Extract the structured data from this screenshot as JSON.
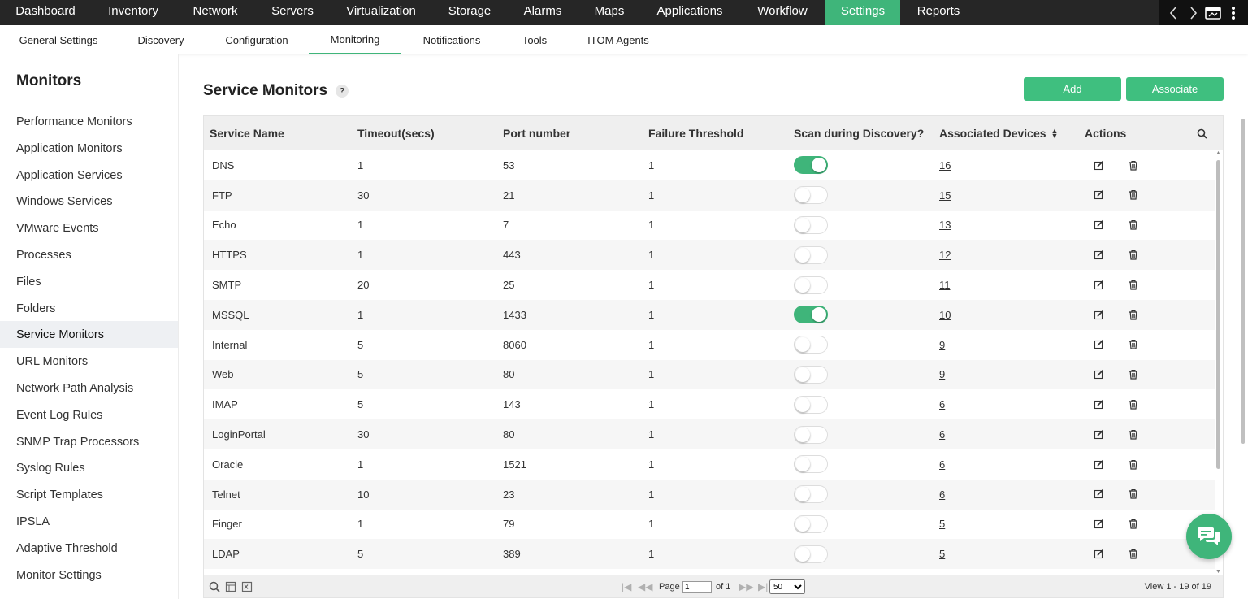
{
  "topnav": {
    "items": [
      {
        "label": "Dashboard",
        "active": false
      },
      {
        "label": "Inventory",
        "active": false
      },
      {
        "label": "Network",
        "active": false
      },
      {
        "label": "Servers",
        "active": false
      },
      {
        "label": "Virtualization",
        "active": false
      },
      {
        "label": "Storage",
        "active": false
      },
      {
        "label": "Alarms",
        "active": false
      },
      {
        "label": "Maps",
        "active": false
      },
      {
        "label": "Applications",
        "active": false
      },
      {
        "label": "Workflow",
        "active": false
      },
      {
        "label": "Settings",
        "active": true
      },
      {
        "label": "Reports",
        "active": false
      }
    ],
    "tools": [
      "chevron-left-icon",
      "chevron-right-icon",
      "window-icon",
      "more-vertical-icon"
    ]
  },
  "subnav": {
    "items": [
      {
        "label": "General Settings",
        "active": false
      },
      {
        "label": "Discovery",
        "active": false
      },
      {
        "label": "Configuration",
        "active": false
      },
      {
        "label": "Monitoring",
        "active": true
      },
      {
        "label": "Notifications",
        "active": false
      },
      {
        "label": "Tools",
        "active": false
      },
      {
        "label": "ITOM Agents",
        "active": false
      }
    ]
  },
  "sidebar": {
    "title": "Monitors",
    "items": [
      {
        "label": "Performance Monitors",
        "active": false
      },
      {
        "label": "Application Monitors",
        "active": false
      },
      {
        "label": "Application Services",
        "active": false
      },
      {
        "label": "Windows Services",
        "active": false
      },
      {
        "label": "VMware Events",
        "active": false
      },
      {
        "label": "Processes",
        "active": false
      },
      {
        "label": "Files",
        "active": false
      },
      {
        "label": "Folders",
        "active": false
      },
      {
        "label": "Service Monitors",
        "active": true
      },
      {
        "label": "URL Monitors",
        "active": false
      },
      {
        "label": "Network Path Analysis",
        "active": false
      },
      {
        "label": "Event Log Rules",
        "active": false
      },
      {
        "label": "SNMP Trap Processors",
        "active": false
      },
      {
        "label": "Syslog Rules",
        "active": false
      },
      {
        "label": "Script Templates",
        "active": false
      },
      {
        "label": "IPSLA",
        "active": false
      },
      {
        "label": "Adaptive Threshold",
        "active": false
      },
      {
        "label": "Monitor Settings",
        "active": false
      }
    ]
  },
  "main": {
    "title": "Service Monitors",
    "help": "?",
    "add_label": "Add",
    "associate_label": "Associate"
  },
  "table": {
    "headers": {
      "service_name": "Service Name",
      "timeout": "Timeout(secs)",
      "port": "Port number",
      "failure": "Failure Threshold",
      "scan": "Scan during Discovery?",
      "devices": "Associated Devices",
      "actions": "Actions"
    },
    "rows": [
      {
        "name": "DNS",
        "timeout": "1",
        "port": "53",
        "failure": "1",
        "scan": true,
        "devices": "16"
      },
      {
        "name": "FTP",
        "timeout": "30",
        "port": "21",
        "failure": "1",
        "scan": false,
        "devices": "15"
      },
      {
        "name": "Echo",
        "timeout": "1",
        "port": "7",
        "failure": "1",
        "scan": false,
        "devices": "13"
      },
      {
        "name": "HTTPS",
        "timeout": "1",
        "port": "443",
        "failure": "1",
        "scan": false,
        "devices": "12"
      },
      {
        "name": "SMTP",
        "timeout": "20",
        "port": "25",
        "failure": "1",
        "scan": false,
        "devices": "11"
      },
      {
        "name": "MSSQL",
        "timeout": "1",
        "port": "1433",
        "failure": "1",
        "scan": true,
        "devices": "10"
      },
      {
        "name": "Internal",
        "timeout": "5",
        "port": "8060",
        "failure": "1",
        "scan": false,
        "devices": "9"
      },
      {
        "name": "Web",
        "timeout": "5",
        "port": "80",
        "failure": "1",
        "scan": false,
        "devices": "9"
      },
      {
        "name": "IMAP",
        "timeout": "5",
        "port": "143",
        "failure": "1",
        "scan": false,
        "devices": "6"
      },
      {
        "name": "LoginPortal",
        "timeout": "30",
        "port": "80",
        "failure": "1",
        "scan": false,
        "devices": "6"
      },
      {
        "name": "Oracle",
        "timeout": "1",
        "port": "1521",
        "failure": "1",
        "scan": false,
        "devices": "6"
      },
      {
        "name": "Telnet",
        "timeout": "10",
        "port": "23",
        "failure": "1",
        "scan": false,
        "devices": "6"
      },
      {
        "name": "Finger",
        "timeout": "1",
        "port": "79",
        "failure": "1",
        "scan": false,
        "devices": "5"
      },
      {
        "name": "LDAP",
        "timeout": "5",
        "port": "389",
        "failure": "1",
        "scan": false,
        "devices": "5"
      }
    ]
  },
  "pager": {
    "page_label": "Page",
    "page_value": "1",
    "of_label": "of 1",
    "page_size": "50",
    "page_size_options": [
      "50"
    ],
    "summary": "View 1 - 19 of 19"
  },
  "colors": {
    "accent": "#3fb57a",
    "topnav_bg": "#262626"
  }
}
